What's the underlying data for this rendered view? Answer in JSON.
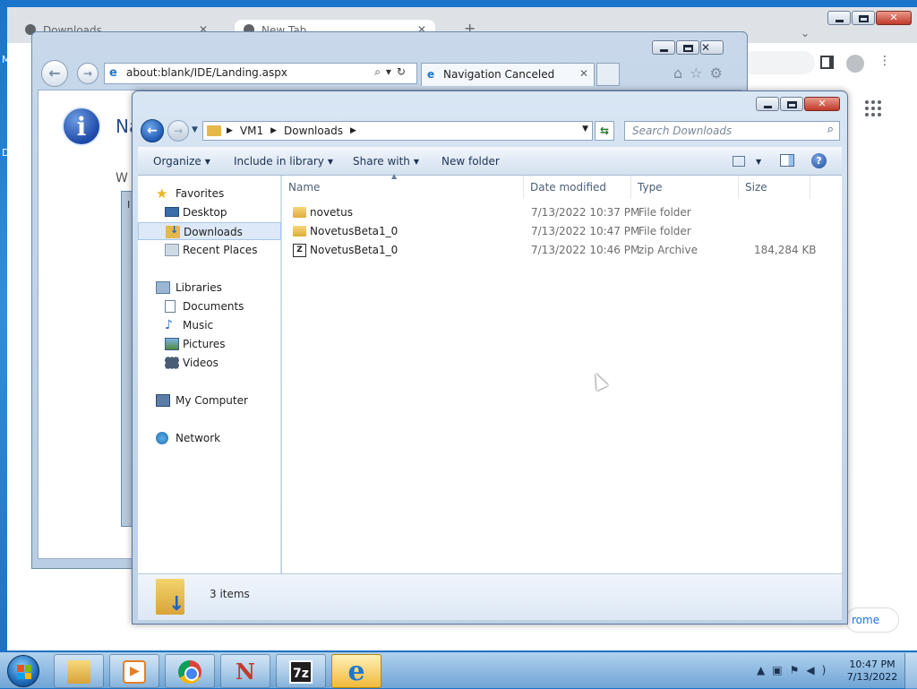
{
  "desktop": {
    "left_labels": [
      "M",
      "D"
    ]
  },
  "chrome": {
    "tabs": [
      {
        "label": "Downloads",
        "active": false
      },
      {
        "label": "New Tab",
        "active": true
      }
    ],
    "bottom_button": "rome"
  },
  "ie": {
    "address": "about:blank/IDE/Landing.aspx",
    "tab_label": "Navigation Canceled",
    "heading": "Na",
    "subtext": "W",
    "inner_dialog_label": "I"
  },
  "explorer": {
    "breadcrumb": [
      "VM1",
      "Downloads"
    ],
    "search_placeholder": "Search Downloads",
    "commands": {
      "organize": "Organize",
      "include_in_library": "Include in library",
      "share_with": "Share with",
      "new_folder": "New folder"
    },
    "nav": {
      "favorites": "Favorites",
      "desktop": "Desktop",
      "downloads": "Downloads",
      "recent_places": "Recent Places",
      "libraries": "Libraries",
      "documents": "Documents",
      "music": "Music",
      "pictures": "Pictures",
      "videos": "Videos",
      "my_computer": "My Computer",
      "network": "Network"
    },
    "columns": {
      "name": "Name",
      "date_modified": "Date modified",
      "type": "Type",
      "size": "Size"
    },
    "files": [
      {
        "name": "novetus",
        "date": "7/13/2022 10:37 PM",
        "type": "File folder",
        "size": "",
        "icon": "folder-icon"
      },
      {
        "name": "NovetusBeta1_0",
        "date": "7/13/2022 10:47 PM",
        "type": "File folder",
        "size": "",
        "icon": "folder-icon"
      },
      {
        "name": "NovetusBeta1_0",
        "date": "7/13/2022 10:46 PM",
        "type": "zip Archive",
        "size": "184,284 KB",
        "icon": "zip-archive-icon"
      }
    ],
    "status": "3 items"
  },
  "taskbar": {
    "apps": [
      "windows-explorer",
      "media-player",
      "google-chrome",
      "novetus",
      "7-zip",
      "internet-explorer"
    ],
    "active_app": "internet-explorer",
    "clock_time": "10:47 PM",
    "clock_date": "7/13/2022"
  },
  "colors": {
    "desktop_blue": "#1a74c9",
    "selection": "#dde9f8",
    "folder_yellow": "#e4b84c"
  }
}
